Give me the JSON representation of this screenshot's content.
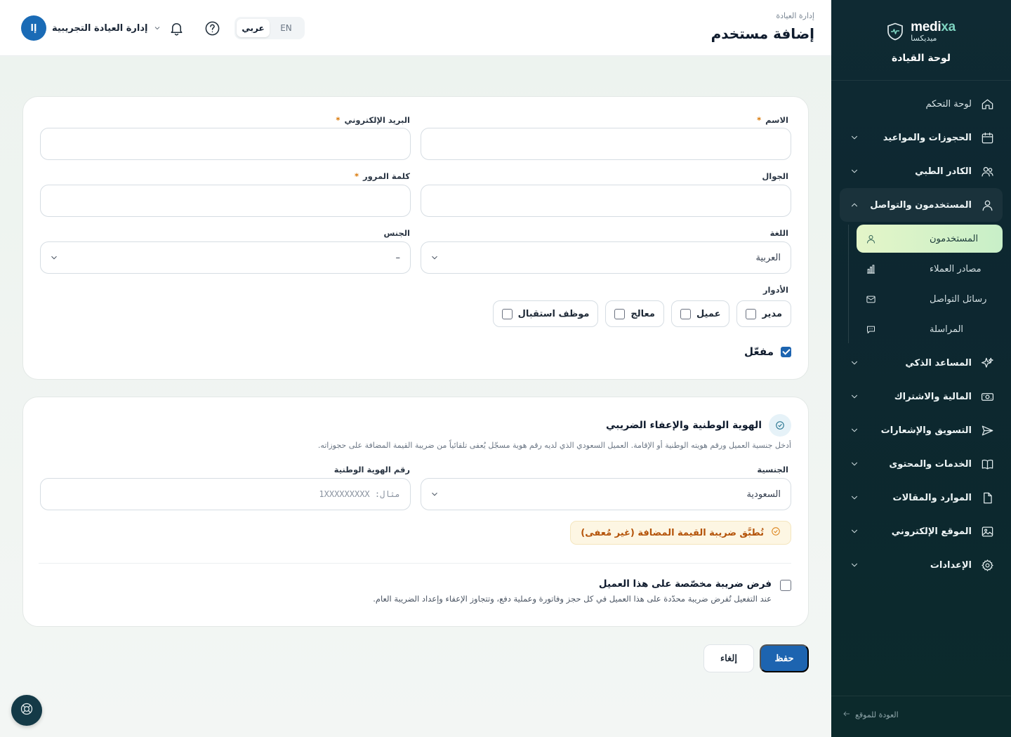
{
  "brand": {
    "name_latin_a": "medi",
    "name_latin_b": "xa",
    "name_ar": "ميديكسا",
    "subtitle": "لوحة القيادة"
  },
  "sidebar": {
    "items": [
      {
        "label": "لوحة التحكم",
        "icon": "home-icon"
      },
      {
        "label": "الحجوزات والمواعيد",
        "icon": "calendar-icon"
      },
      {
        "label": "الكادر الطبي",
        "icon": "users-icon"
      },
      {
        "label": "المستخدمون والتواصل",
        "icon": "user-icon"
      },
      {
        "label": "المساعد الذكي",
        "icon": "sparkles-icon"
      },
      {
        "label": "المالية والاشتراك",
        "icon": "money-icon"
      },
      {
        "label": "التسويق والإشعارات",
        "icon": "send-icon"
      },
      {
        "label": "الخدمات والمحتوى",
        "icon": "book-icon"
      },
      {
        "label": "الموارد والمقالات",
        "icon": "file-icon"
      },
      {
        "label": "الموقع الإلكتروني",
        "icon": "image-icon"
      },
      {
        "label": "الإعدادات",
        "icon": "gear-icon"
      }
    ],
    "subitems": [
      {
        "label": "المستخدمون",
        "icon": "user-icon",
        "active": true
      },
      {
        "label": "مصادر العملاء",
        "icon": "bar-chart-icon"
      },
      {
        "label": "رسائل التواصل",
        "icon": "mail-icon"
      },
      {
        "label": "المراسلة",
        "icon": "chat-icon"
      }
    ],
    "back_link": "العودة للموقع"
  },
  "header": {
    "breadcrumb": "إدارة العيادة",
    "title": "إضافة مستخدم",
    "lang_ar": "عربي",
    "lang_en": "EN",
    "account_name": "إدارة العيادة التجريبية",
    "avatar_initials": "إا"
  },
  "form": {
    "name_label": "الاسم",
    "email_label": "البريد الإلكتروني",
    "mobile_label": "الجوال",
    "password_label": "كلمة المرور",
    "language_label": "اللغة",
    "language_value": "العربية",
    "gender_label": "الجنس",
    "gender_value": "–",
    "roles_label": "الأدوار",
    "roles": [
      "مدير",
      "عميل",
      "معالج",
      "موظف استقبال"
    ],
    "active_label": "مفعّل",
    "active_checked": true,
    "required_mark": "*"
  },
  "identity": {
    "title": "الهوية الوطنية والإعفاء الضريبي",
    "description": "أدخل جنسية العميل ورقم هويته الوطنية أو الإقامة. العميل السعودي الذي لديه رقم هوية مسجّل يُعفى تلقائياً من ضريبة القيمة المضافة على حجوزاته.",
    "nationality_label": "الجنسية",
    "nationality_value": "السعودية",
    "national_id_label": "رقم الهوية الوطنية",
    "national_id_placeholder": "مثال: 1XXXXXXXXX",
    "vat_status": "تُطبَّق ضريبة القيمة المضافة (غير مُعفى)",
    "custom_tax_title": "فرض ضريبة مخصّصة على هذا العميل",
    "custom_tax_desc": "عند التفعيل تُفرض ضريبة محدّدة على هذا العميل في كل حجز وفاتورة وعملية دفع، وتتجاوز الإعفاء وإعداد الضريبة العام."
  },
  "actions": {
    "save": "حفظ",
    "cancel": "إلغاء"
  },
  "colors": {
    "primary": "#1d64b0",
    "sidebar_bg": "#0f2a33",
    "active_item": "#d6f2c6",
    "vat_warning": "#b45309"
  }
}
